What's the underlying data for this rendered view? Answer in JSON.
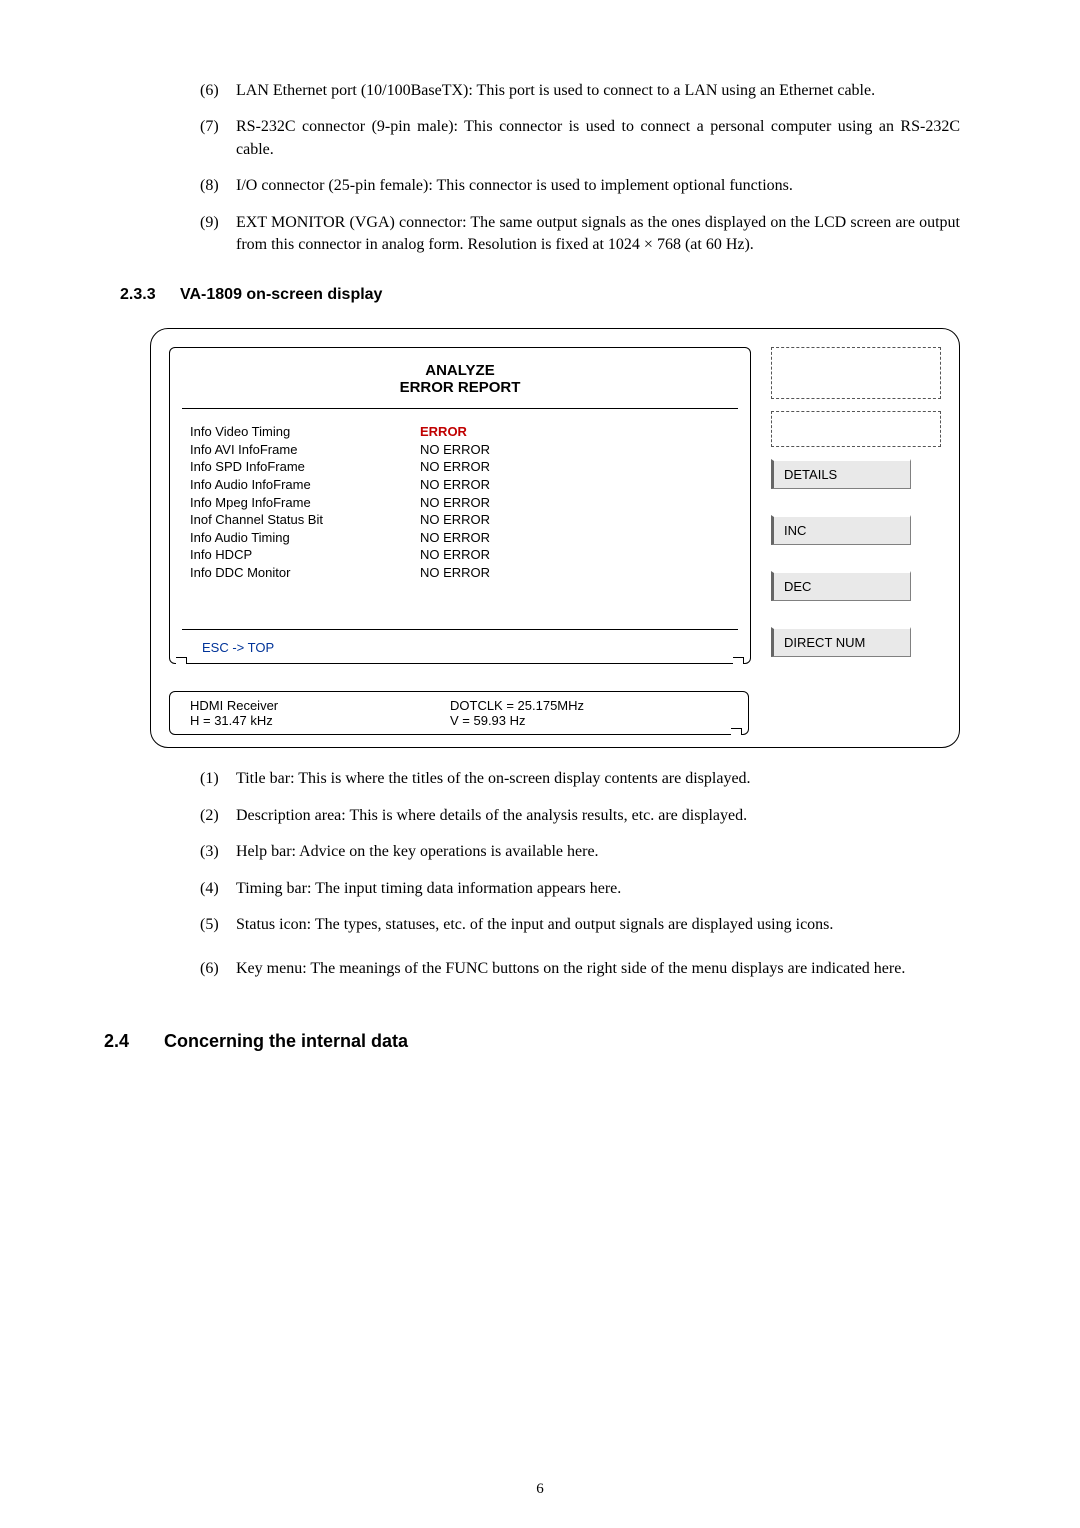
{
  "intro_list": [
    {
      "num": "(6)",
      "text": "LAN Ethernet port (10/100BaseTX): This port is used to connect to a LAN using an Ethernet cable."
    },
    {
      "num": "(7)",
      "text": "RS-232C connector (9-pin male): This connector is used to connect a personal computer using an RS-232C cable."
    },
    {
      "num": "(8)",
      "text": "I/O connector (25-pin female): This connector is used to implement optional functions."
    },
    {
      "num": "(9)",
      "text": "EXT MONITOR (VGA) connector: The same output signals as the ones displayed on the LCD screen are output from this connector in analog form. Resolution is fixed at 1024 × 768 (at 60 Hz)."
    }
  ],
  "section233": {
    "num": "2.3.3",
    "title": "VA-1809 on-screen display"
  },
  "diagram": {
    "title_line1": "ANALYZE",
    "title_line2": "ERROR REPORT",
    "rows": [
      {
        "label": "Info Video Timing",
        "value": "ERROR",
        "error": true
      },
      {
        "label": "Info AVI InfoFrame",
        "value": "NO ERROR",
        "error": false
      },
      {
        "label": "Info SPD InfoFrame",
        "value": "NO ERROR",
        "error": false
      },
      {
        "label": "Info Audio InfoFrame",
        "value": "NO ERROR",
        "error": false
      },
      {
        "label": "Info Mpeg InfoFrame",
        "value": "NO ERROR",
        "error": false
      },
      {
        "label": "Inof Channel Status Bit",
        "value": "NO ERROR",
        "error": false
      },
      {
        "label": "Info Audio Timing",
        "value": "NO ERROR",
        "error": false
      },
      {
        "label": "Info HDCP",
        "value": "NO ERROR",
        "error": false
      },
      {
        "label": "Info DDC Monitor",
        "value": "NO ERROR",
        "error": false
      }
    ],
    "help_text": "ESC -> TOP",
    "timing": {
      "left1": "HDMI Receiver",
      "left2": "H = 31.47 kHz",
      "right1": "DOTCLK = 25.175MHz",
      "right2": "V = 59.93 Hz"
    },
    "buttons": {
      "details": "DETAILS",
      "inc": "INC",
      "dec": "DEC",
      "direct": "DIRECT NUM"
    }
  },
  "below_list": [
    {
      "num": "(1)",
      "text": "Title bar: This is where the titles of the on-screen display contents are displayed."
    },
    {
      "num": "(2)",
      "text": "Description area: This is where details of the analysis results, etc. are displayed."
    },
    {
      "num": "(3)",
      "text": "Help bar: Advice on the key operations is available here."
    },
    {
      "num": "(4)",
      "text": "Timing bar: The input timing data information appears here."
    },
    {
      "num": "(5)",
      "text": "Status icon: The types, statuses, etc. of the input and output signals are displayed using icons."
    },
    {
      "num": "(6)",
      "text": "Key menu: The meanings of the FUNC buttons on the right side of the menu displays are indicated here."
    }
  ],
  "section24": {
    "num": "2.4",
    "title": "Concerning the internal data"
  },
  "page_number": "6"
}
